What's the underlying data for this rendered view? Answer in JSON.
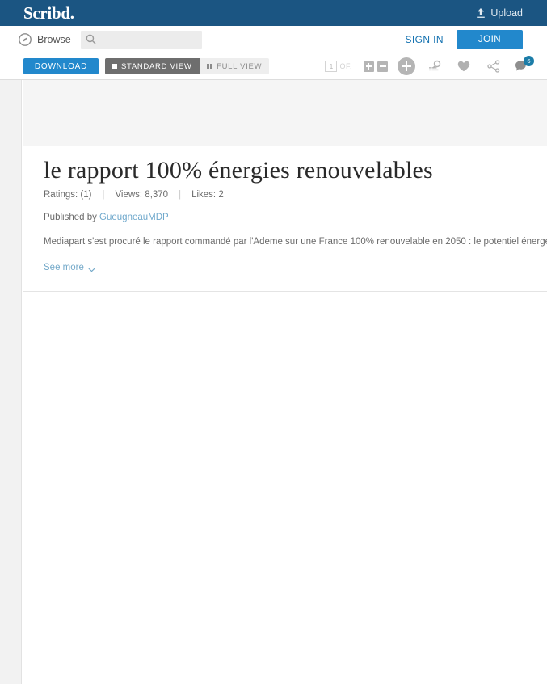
{
  "header": {
    "logo_text": "Scribd.",
    "upload_label": "Upload",
    "upload_icon": "upload-arrow-icon",
    "brand_bg": "#1b5582"
  },
  "nav": {
    "browse_label": "Browse",
    "browse_icon": "compass-icon",
    "search_icon": "search-icon",
    "search_value": "",
    "search_placeholder": "",
    "signin_label": "SIGN IN",
    "join_label": "JOIN",
    "join_color": "#2288cc"
  },
  "doc_toolbar": {
    "download_label": "DOWNLOAD",
    "standard_view_label": "STANDARD VIEW",
    "full_view_label": "FULL VIEW",
    "active_view": "STANDARD VIEW",
    "page_current": "1",
    "page_of_label": "OF.",
    "zoom_in_icon": "zoom-in-icon",
    "zoom_out_icon": "zoom-out-icon",
    "add_icon": "plus-circle-icon",
    "doc_search_icon": "search-in-document-icon",
    "like_icon": "heart-icon",
    "share_icon": "share-icon",
    "comments_icon": "comment-bubble-icon",
    "comments_count": "6",
    "badge_color": "#1c7da8"
  },
  "document": {
    "title": "le rapport 100% énergies renouvelables",
    "stats": {
      "ratings_label": "Ratings: (1)",
      "views_label": "Views: 8,370",
      "likes_label": "Likes: 2",
      "separator": "|"
    },
    "published_prefix": "Published by ",
    "publisher": "GueugneauMDP",
    "description": "Mediapart s'est procuré le rapport commandé par l'Ademe sur une France 100% renouvelable en 2050 : le potentiel énergétique e",
    "see_more_label": "See more",
    "chevron_icon": "chevron-down-icon"
  }
}
